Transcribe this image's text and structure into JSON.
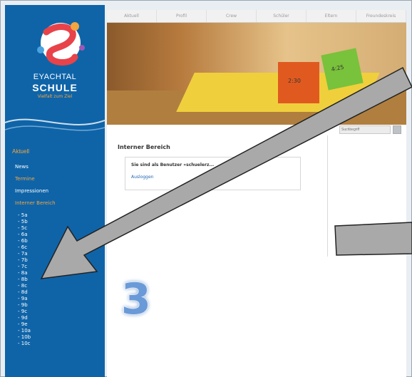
{
  "logo": {
    "line1": "EYACHTAL",
    "line2": "SCHULE",
    "tagline": "Vielfalt zum Ziel"
  },
  "top_nav": [
    "Aktuell",
    "Profil",
    "Crew",
    "Schüler",
    "Eltern",
    "Freundeskreis"
  ],
  "hero": {
    "cube1": "2:30",
    "cube2": "4:25"
  },
  "sidebar": {
    "heading": "Aktuell",
    "items": [
      {
        "label": "News",
        "orange": false
      },
      {
        "label": "Termine",
        "orange": true
      },
      {
        "label": "Impressionen",
        "orange": false
      },
      {
        "label": "Interner Bereich",
        "orange": true
      }
    ],
    "classes": [
      "- 5a",
      "- 5b",
      "- 5c",
      "- 6a",
      "- 6b",
      "- 6c",
      "- 7a",
      "- 7b",
      "- 7c",
      "- 8a",
      "- 8b",
      "- 8c",
      "- 8d",
      "- 9a",
      "- 9b",
      "- 9c",
      "- 9d",
      "- 9e",
      "- 10a",
      "- 10b",
      "- 10c"
    ]
  },
  "search": {
    "placeholder": "Suchbegriff"
  },
  "main": {
    "title": "Interner Bereich",
    "message": "Sie sind als Benutzer »schuelerz...",
    "logout": "Ausloggen"
  },
  "annotation": {
    "step_number": "3"
  },
  "colors": {
    "sidebar": "#0f64a8",
    "accent": "#f4a640",
    "link": "#1f67b1",
    "arrow": "#a9a9a9"
  }
}
